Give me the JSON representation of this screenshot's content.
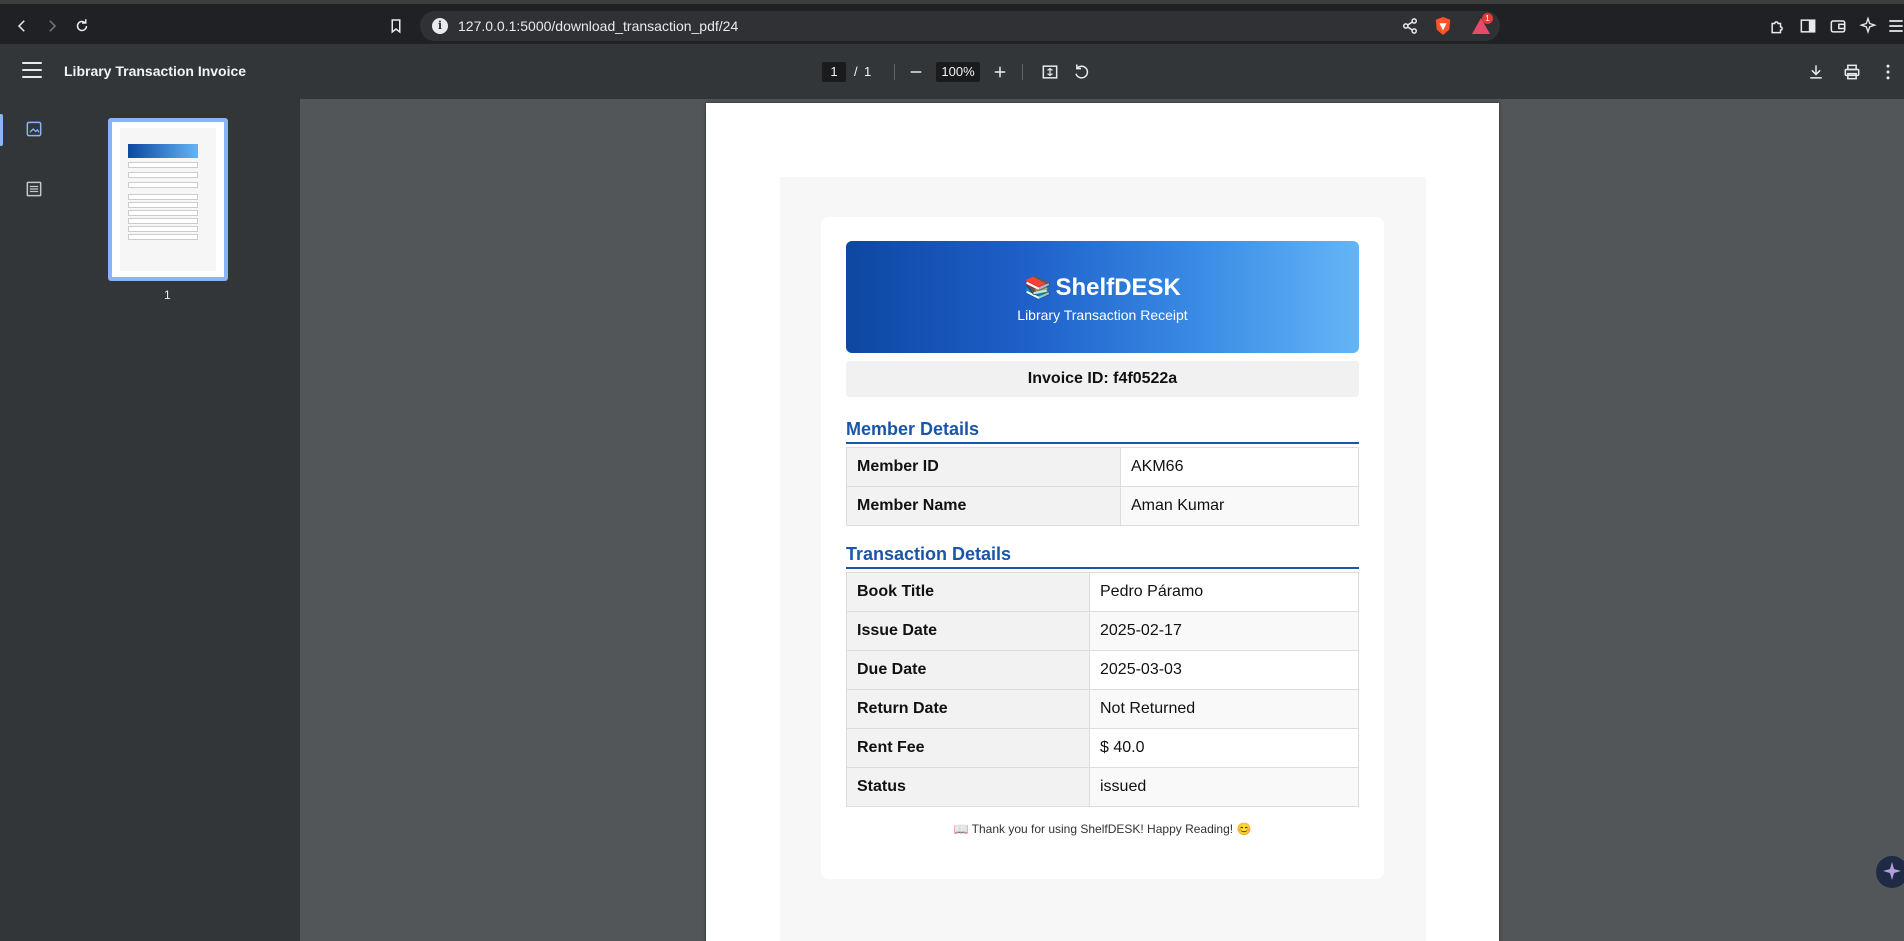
{
  "browser": {
    "url": "127.0.0.1:5000/download_transaction_pdf/24",
    "alert_count": "1"
  },
  "toolbar": {
    "title": "Library Transaction Invoice",
    "page_current": "1",
    "page_separator": "/",
    "page_total": "1",
    "zoom": "100%"
  },
  "sidebar": {
    "thumbnail_label": "1"
  },
  "document": {
    "brand_icon": "📚",
    "brand": "ShelfDESK",
    "subtitle": "Library Transaction Receipt",
    "invoice_id": "Invoice ID: f4f0522a",
    "member_section_title": "Member Details",
    "member_rows": [
      {
        "label": "Member ID",
        "value": "AKM66"
      },
      {
        "label": "Member Name",
        "value": "Aman Kumar"
      }
    ],
    "transaction_section_title": "Transaction Details",
    "transaction_rows": [
      {
        "label": "Book Title",
        "value": "Pedro Páramo"
      },
      {
        "label": "Issue Date",
        "value": "2025-02-17"
      },
      {
        "label": "Due Date",
        "value": "2025-03-03"
      },
      {
        "label": "Return Date",
        "value": "Not Returned"
      },
      {
        "label": "Rent Fee",
        "value": "$ 40.0"
      },
      {
        "label": "Status",
        "value": "issued"
      }
    ],
    "footer": "📖 Thank you for using ShelfDESK! Happy Reading! 😊"
  },
  "colors": {
    "accent": "#1a56a8",
    "header_start": "#0d47a1",
    "header_end": "#64b5f6",
    "sidebar_active": "#8ab4f8"
  }
}
